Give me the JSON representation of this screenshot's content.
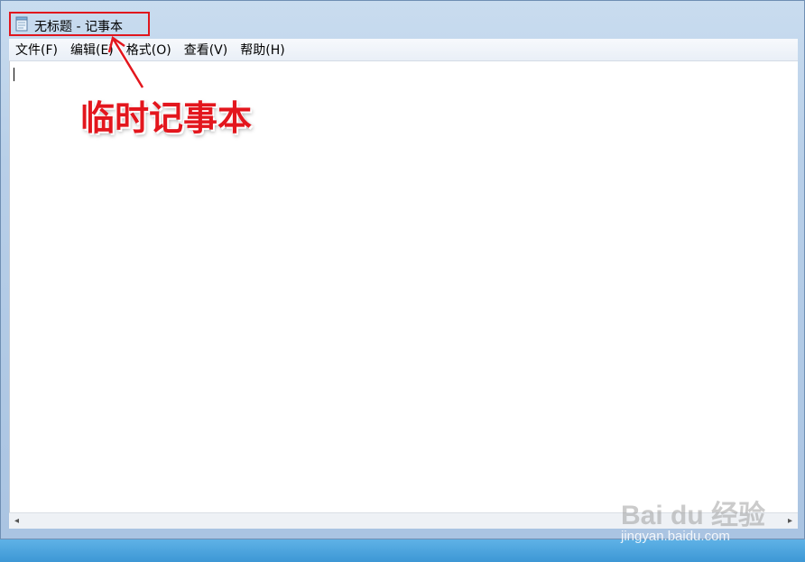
{
  "window": {
    "title": "无标题 - 记事本",
    "icon": "notepad-icon"
  },
  "menu": {
    "items": [
      {
        "label": "文件(F)"
      },
      {
        "label": "编辑(E)"
      },
      {
        "label": "格式(O)"
      },
      {
        "label": "查看(V)"
      },
      {
        "label": "帮助(H)"
      }
    ]
  },
  "editor": {
    "content": ""
  },
  "annotation": {
    "label": "临时记事本",
    "color": "#e3161d"
  },
  "watermark": {
    "brand": "Bai du 经验",
    "url": "jingyan.baidu.com"
  },
  "scrollbar": {
    "left_arrow": "◂",
    "right_arrow": "▸"
  }
}
